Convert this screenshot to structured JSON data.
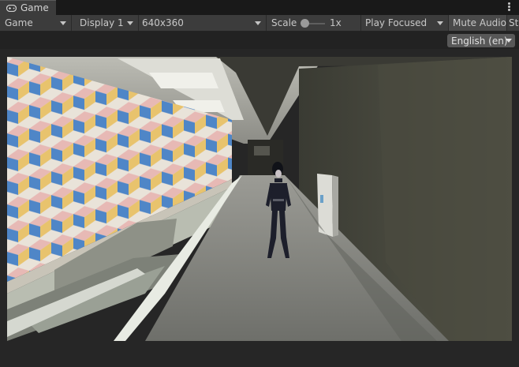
{
  "tab": {
    "label": "Game",
    "icon": "gamepad-icon"
  },
  "toolbar": {
    "view_mode": "Game",
    "display": "Display 1",
    "resolution": "640x360",
    "scale_label": "Scale",
    "scale_value": "1x",
    "play_mode": "Play Focused",
    "mute_audio": "Mute Audio",
    "stats_partial": "St"
  },
  "language": {
    "selected": "English (en)"
  },
  "scene": {
    "description_icon": "game-scene-render"
  }
}
